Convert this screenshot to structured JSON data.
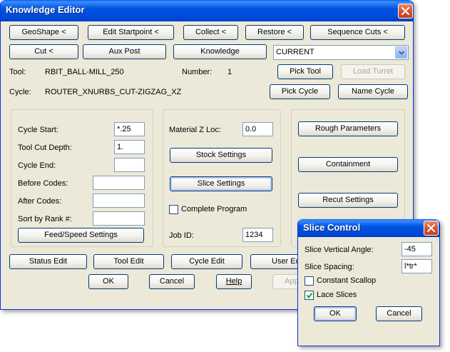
{
  "main_window": {
    "title": "Knowledge Editor",
    "row1": [
      "GeoShape <",
      "Edit Startpoint <",
      "Collect <",
      "Restore <",
      "Sequence Cuts <"
    ],
    "row2": [
      "Cut <",
      "Aux Post",
      "Knowledge"
    ],
    "combo_value": "CURRENT",
    "tool_label": "Tool:",
    "tool_value": "RBIT_BALL-MILL_250",
    "number_label": "Number:",
    "number_value": "1",
    "pick_tool": "Pick Tool",
    "load_turret": "Load Turret",
    "cycle_label": "Cycle:",
    "cycle_value": "ROUTER_XNURBS_CUT-ZIGZAG_XZ",
    "pick_cycle": "Pick Cycle",
    "name_cycle": "Name Cycle",
    "left_group": {
      "cycle_start_label": "Cycle Start:",
      "cycle_start_value": "*.25",
      "tool_cut_depth_label": "Tool Cut Depth:",
      "tool_cut_depth_value": "1.",
      "cycle_end_label": "Cycle End:",
      "cycle_end_value": "",
      "before_codes_label": "Before Codes:",
      "before_codes_value": "",
      "after_codes_label": "After Codes:",
      "after_codes_value": "",
      "sort_by_rank_label": "Sort by Rank #:",
      "sort_by_rank_value": "",
      "feed_speed": "Feed/Speed Settings"
    },
    "mid_group": {
      "material_z_label": "Material Z Loc:",
      "material_z_value": "0.0",
      "stock_settings": "Stock Settings",
      "slice_settings": "Slice Settings",
      "complete_program": "Complete Program",
      "job_id_label": "Job ID:",
      "job_id_value": "1234"
    },
    "right_group": {
      "rough_parameters": "Rough Parameters",
      "containment": "Containment",
      "recut_settings": "Recut Settings"
    },
    "bottom_row": [
      "Status Edit",
      "Tool Edit",
      "Cycle Edit",
      "User Ed"
    ],
    "ok": "OK",
    "cancel": "Cancel",
    "help": "Help",
    "apply": "App"
  },
  "slice_dialog": {
    "title": "Slice Control",
    "vertical_angle_label": "Slice Vertical Angle:",
    "vertical_angle_value": "-45",
    "spacing_label": "Slice Spacing:",
    "spacing_value": "l*tr*",
    "constant_scallop": "Constant Scallop",
    "constant_scallop_checked": false,
    "lace_slices": "Lace Slices",
    "lace_slices_checked": true,
    "ok": "OK",
    "cancel": "Cancel"
  },
  "colors": {
    "title_bar": "#0054e3",
    "close_button": "#d8542b",
    "dialog_face": "#ece9d8",
    "button_border": "#003c74",
    "check_mark": "#21a121"
  },
  "icons": [
    "close-icon",
    "dropdown-arrow-icon",
    "checkmark-icon"
  ]
}
